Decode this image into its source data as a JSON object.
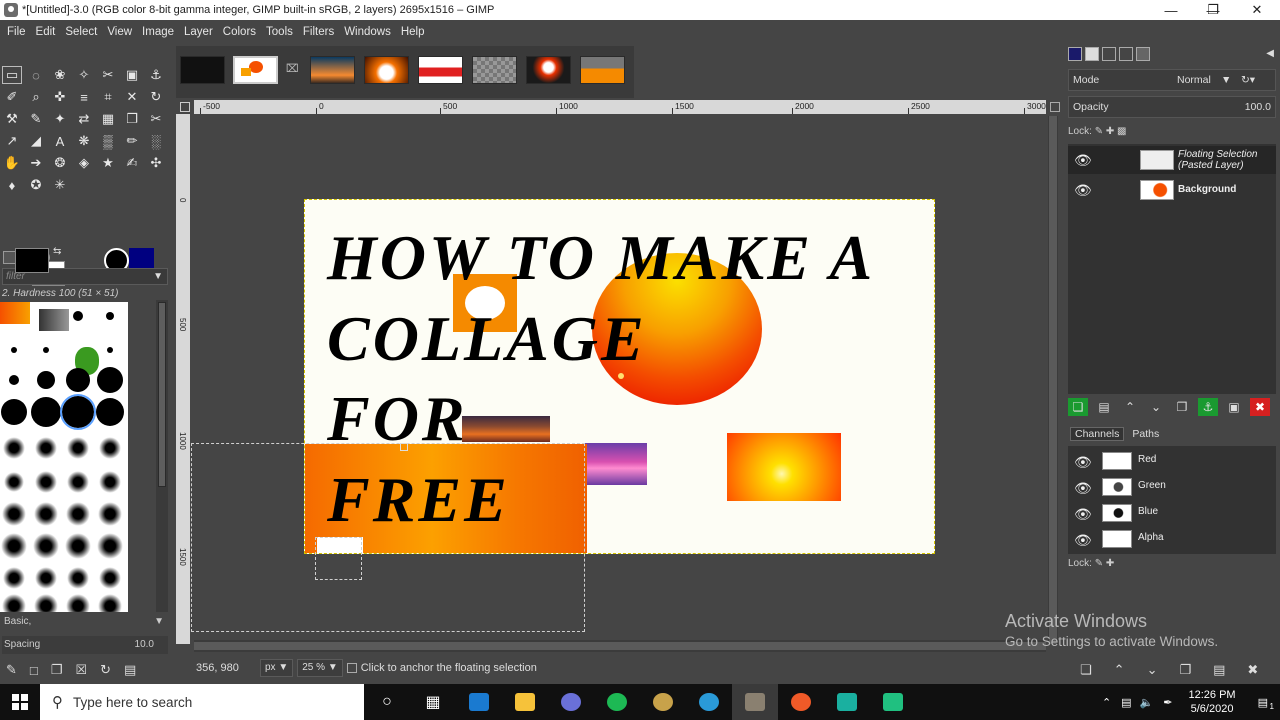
{
  "window": {
    "title": "*[Untitled]-3.0 (RGB color 8-bit gamma integer, GIMP built-in sRGB, 2 layers) 2695x1516 – GIMP",
    "minimize": "—",
    "maximize": "❐",
    "close": "✕"
  },
  "menu": [
    "File",
    "Edit",
    "Select",
    "View",
    "Image",
    "Layer",
    "Colors",
    "Tools",
    "Filters",
    "Windows",
    "Help"
  ],
  "toolbox": {
    "tools": [
      "▭",
      "◌",
      "❀",
      "✧",
      "✂",
      "▣",
      "⚓",
      "✐",
      "⌕",
      "✜",
      "≡",
      "⌗",
      "✕",
      "↻",
      "⚒",
      "✎",
      "✦",
      "⇄",
      "▦",
      "❐",
      "✂",
      "↗",
      "◢",
      "A",
      "❋",
      "▒",
      "✏",
      "░",
      "✋",
      "➔",
      "❂",
      "◈",
      "★",
      "✍",
      "✣",
      "♦",
      "✪",
      "✳"
    ],
    "selected_index": 0,
    "fg_color": "#000000",
    "bg_color": "#ffffff"
  },
  "brushes": {
    "filter_placeholder": "filter",
    "current": "2. Hardness 100 (51 × 51)",
    "tag": "Basic,",
    "spacing_label": "Spacing",
    "spacing_value": "10.0"
  },
  "ruler": {
    "h_labels": [
      "-500",
      "0",
      "500",
      "1000",
      "1500",
      "2000",
      "2500",
      "3000"
    ],
    "v_labels": [
      "0",
      "500",
      "1000",
      "1500"
    ]
  },
  "canvas_text": {
    "line1": "HOW TO MAKE A",
    "line2": "COLLAGE",
    "line3": "FOR",
    "line4": "FREE"
  },
  "status": {
    "coords": "356, 980",
    "unit": "px",
    "zoom": "25 %",
    "message": "Click to anchor the floating selection"
  },
  "dock": {
    "mode_label": "Mode",
    "mode_value": "Normal",
    "opacity_label": "Opacity",
    "opacity_value": "100.0",
    "lock_label": "Lock:",
    "layers": [
      {
        "name": "Floating Selection\n(Pasted Layer)",
        "italic": true
      },
      {
        "name": "Background",
        "italic": false
      }
    ],
    "tabs": [
      "Channels",
      "Paths"
    ],
    "channels": [
      "Red",
      "Green",
      "Blue",
      "Alpha"
    ]
  },
  "watermark": {
    "line1": "Activate Windows",
    "line2": "Go to Settings to activate Windows."
  },
  "taskbar": {
    "search_placeholder": "Type here to search",
    "time": "12:26 PM",
    "date": "5/6/2020",
    "notification_count": "1"
  },
  "colors": {
    "accent_green": "#1a9a30",
    "accent_red": "#d62020",
    "selection_yellow": "#d4c400"
  }
}
